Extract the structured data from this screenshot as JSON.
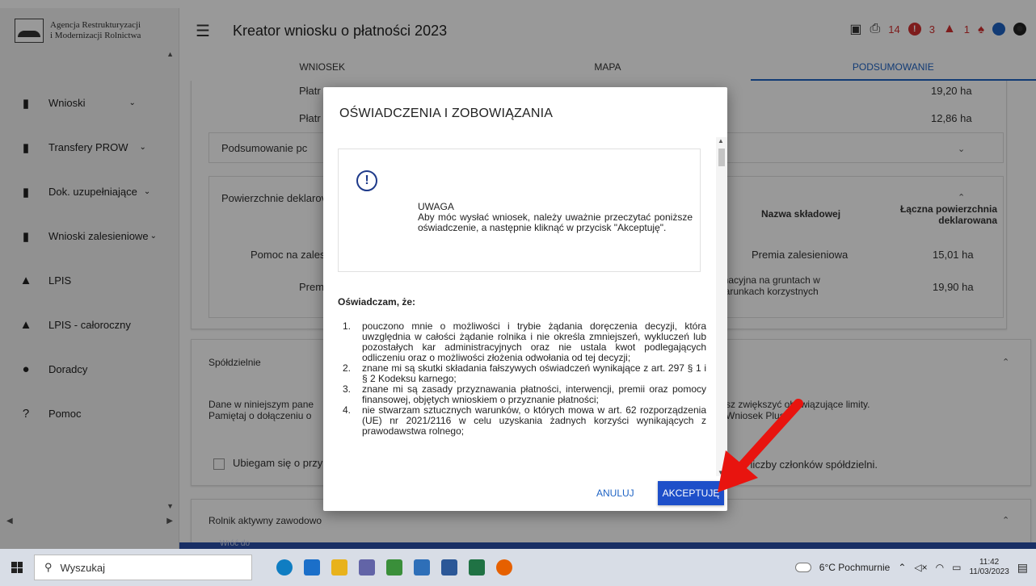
{
  "logo": {
    "line1": "Agencja Restrukturyzacji",
    "line2": "i Modernizacji Rolnictwa"
  },
  "sidebar": {
    "items": [
      {
        "label": "Wnioski",
        "icon": "clipboard-icon",
        "chevron": true
      },
      {
        "label": "Transfery PROW",
        "icon": "clipboard-icon",
        "chevron": true
      },
      {
        "label": "Dok. uzupełniające",
        "icon": "clipboard-icon",
        "chevron": true
      },
      {
        "label": "Wnioski zalesieniowe",
        "icon": "clipboard-icon",
        "chevron": true
      },
      {
        "label": "LPIS",
        "icon": "mountain-icon",
        "chevron": false
      },
      {
        "label": "LPIS - całoroczny",
        "icon": "mountain-icon",
        "chevron": false
      },
      {
        "label": "Doradcy",
        "icon": "person-icon",
        "chevron": false
      },
      {
        "label": "Pomoc",
        "icon": "help-icon",
        "chevron": false
      }
    ]
  },
  "header": {
    "title": "Kreator wniosku o płatności 2023",
    "errors_count": "14",
    "warnings_count": "3",
    "notifications_count": "1"
  },
  "tabs": [
    "WNIOSEK",
    "MAPA",
    "PODSUMOWANIE"
  ],
  "background": {
    "row1_left": "Płatr",
    "row1_right": "19,20 ha",
    "row2_left": "Płatr",
    "row2_right": "12,86 ha",
    "summary_label": "Podsumowanie pc",
    "area_label": "Powierzchnie deklarov",
    "col_name": "Nazwa składowej",
    "col_total": "Łączna powierzchnia deklarowana",
    "aid_left": "Pomoc na zales",
    "aid_name": "Premia zalesieniowa",
    "aid_value": "15,01 ha",
    "prem_left": "Premi",
    "prem_name": "gnacyjna na gruntach w warunkach korzystnych",
    "prem_value": "19,90 ha",
    "coop_title": "Spółdzielnie",
    "coop_text1": "Dane w niniejszym pane",
    "coop_text1b": "sz zwiększyć obowiązujące limity.",
    "coop_text2": "Pamiętaj o dołączeniu o",
    "coop_text2b": "Wniosek Plus.",
    "coop_checkbox": "Ubiegam się o przy",
    "coop_checkbox_b": "m liczby członków spółdzielni.",
    "farmer_title": "Rolnik aktywny zawodowo",
    "back_label": "Wróć do"
  },
  "modal": {
    "title": "OŚWIADCZENIA I ZOBOWIĄZANIA",
    "notice_title": "UWAGA",
    "notice_text": "Aby móc wysłać wniosek, należy uważnie przeczytać poniższe oświadczenie, a następnie kliknąć w przycisk \"Akceptuję\".",
    "decl_head": "Oświadczam, że:",
    "declarations": [
      {
        "num": "1.",
        "text": "pouczono mnie o możliwości i trybie żądania doręczenia decyzji, która uwzględnia w całości żądanie rolnika i nie określa zmniejszeń, wykluczeń lub pozostałych kar administracyjnych oraz nie ustala kwot podlegających odliczeniu oraz o możliwości złożenia odwołania od tej decyzji;"
      },
      {
        "num": "2.",
        "text": "znane mi są skutki składania fałszywych oświadczeń wynikające z art. 297 § 1 i § 2 Kodeksu karnego;"
      },
      {
        "num": "3.",
        "text": "znane mi są zasady przyznawania płatności, interwencji, premii oraz pomocy finansowej, objętych wnioskiem o przyznanie płatności;"
      },
      {
        "num": "4.",
        "text": "nie stwarzam sztucznych warunków, o których mowa w art. 62 rozporządzenia (UE) nr 2021/2116 w celu uzyskania żadnych korzyści wynikających z prawodawstwa rolnego;"
      }
    ],
    "cancel_label": "ANULUJ",
    "accept_label": "AKCEPTUJĘ"
  },
  "taskbar": {
    "search_placeholder": "Wyszukaj",
    "weather": "6°C Pochmurnie",
    "time": "11:42",
    "date": "11/03/2023"
  },
  "colors": {
    "accent": "#1e63c4",
    "accept_button": "#1e4fc9",
    "error": "#d32f2f",
    "arrow": "#e8140f"
  }
}
